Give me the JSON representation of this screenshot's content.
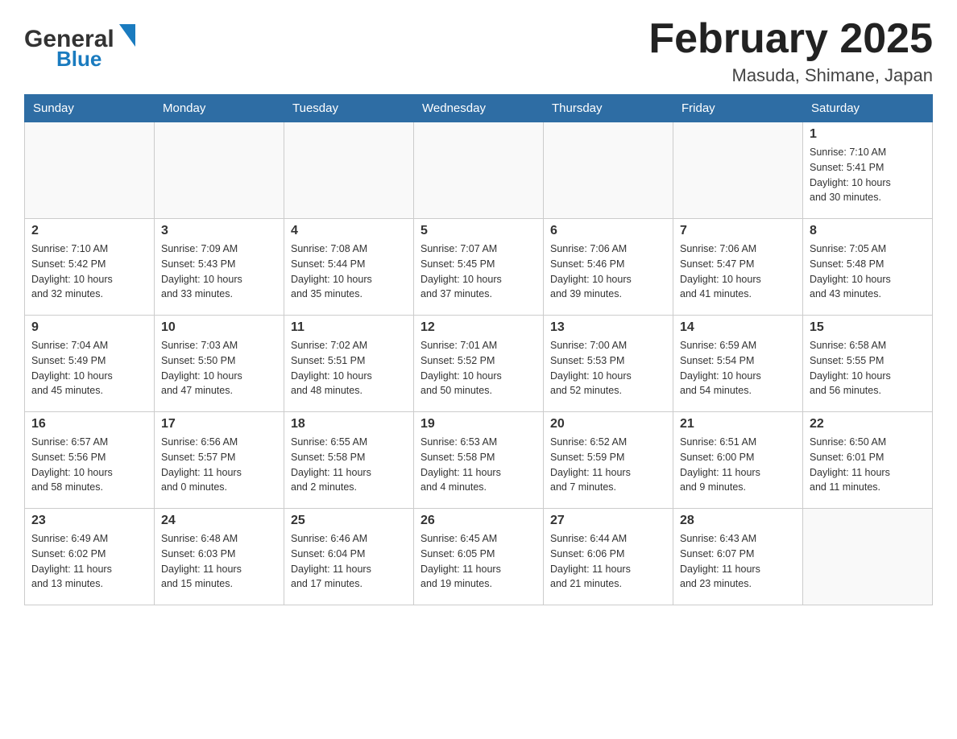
{
  "header": {
    "logo_general": "General",
    "logo_blue": "Blue",
    "month_title": "February 2025",
    "location": "Masuda, Shimane, Japan"
  },
  "weekdays": [
    "Sunday",
    "Monday",
    "Tuesday",
    "Wednesday",
    "Thursday",
    "Friday",
    "Saturday"
  ],
  "weeks": [
    [
      {
        "day": "",
        "info": ""
      },
      {
        "day": "",
        "info": ""
      },
      {
        "day": "",
        "info": ""
      },
      {
        "day": "",
        "info": ""
      },
      {
        "day": "",
        "info": ""
      },
      {
        "day": "",
        "info": ""
      },
      {
        "day": "1",
        "info": "Sunrise: 7:10 AM\nSunset: 5:41 PM\nDaylight: 10 hours\nand 30 minutes."
      }
    ],
    [
      {
        "day": "2",
        "info": "Sunrise: 7:10 AM\nSunset: 5:42 PM\nDaylight: 10 hours\nand 32 minutes."
      },
      {
        "day": "3",
        "info": "Sunrise: 7:09 AM\nSunset: 5:43 PM\nDaylight: 10 hours\nand 33 minutes."
      },
      {
        "day": "4",
        "info": "Sunrise: 7:08 AM\nSunset: 5:44 PM\nDaylight: 10 hours\nand 35 minutes."
      },
      {
        "day": "5",
        "info": "Sunrise: 7:07 AM\nSunset: 5:45 PM\nDaylight: 10 hours\nand 37 minutes."
      },
      {
        "day": "6",
        "info": "Sunrise: 7:06 AM\nSunset: 5:46 PM\nDaylight: 10 hours\nand 39 minutes."
      },
      {
        "day": "7",
        "info": "Sunrise: 7:06 AM\nSunset: 5:47 PM\nDaylight: 10 hours\nand 41 minutes."
      },
      {
        "day": "8",
        "info": "Sunrise: 7:05 AM\nSunset: 5:48 PM\nDaylight: 10 hours\nand 43 minutes."
      }
    ],
    [
      {
        "day": "9",
        "info": "Sunrise: 7:04 AM\nSunset: 5:49 PM\nDaylight: 10 hours\nand 45 minutes."
      },
      {
        "day": "10",
        "info": "Sunrise: 7:03 AM\nSunset: 5:50 PM\nDaylight: 10 hours\nand 47 minutes."
      },
      {
        "day": "11",
        "info": "Sunrise: 7:02 AM\nSunset: 5:51 PM\nDaylight: 10 hours\nand 48 minutes."
      },
      {
        "day": "12",
        "info": "Sunrise: 7:01 AM\nSunset: 5:52 PM\nDaylight: 10 hours\nand 50 minutes."
      },
      {
        "day": "13",
        "info": "Sunrise: 7:00 AM\nSunset: 5:53 PM\nDaylight: 10 hours\nand 52 minutes."
      },
      {
        "day": "14",
        "info": "Sunrise: 6:59 AM\nSunset: 5:54 PM\nDaylight: 10 hours\nand 54 minutes."
      },
      {
        "day": "15",
        "info": "Sunrise: 6:58 AM\nSunset: 5:55 PM\nDaylight: 10 hours\nand 56 minutes."
      }
    ],
    [
      {
        "day": "16",
        "info": "Sunrise: 6:57 AM\nSunset: 5:56 PM\nDaylight: 10 hours\nand 58 minutes."
      },
      {
        "day": "17",
        "info": "Sunrise: 6:56 AM\nSunset: 5:57 PM\nDaylight: 11 hours\nand 0 minutes."
      },
      {
        "day": "18",
        "info": "Sunrise: 6:55 AM\nSunset: 5:58 PM\nDaylight: 11 hours\nand 2 minutes."
      },
      {
        "day": "19",
        "info": "Sunrise: 6:53 AM\nSunset: 5:58 PM\nDaylight: 11 hours\nand 4 minutes."
      },
      {
        "day": "20",
        "info": "Sunrise: 6:52 AM\nSunset: 5:59 PM\nDaylight: 11 hours\nand 7 minutes."
      },
      {
        "day": "21",
        "info": "Sunrise: 6:51 AM\nSunset: 6:00 PM\nDaylight: 11 hours\nand 9 minutes."
      },
      {
        "day": "22",
        "info": "Sunrise: 6:50 AM\nSunset: 6:01 PM\nDaylight: 11 hours\nand 11 minutes."
      }
    ],
    [
      {
        "day": "23",
        "info": "Sunrise: 6:49 AM\nSunset: 6:02 PM\nDaylight: 11 hours\nand 13 minutes."
      },
      {
        "day": "24",
        "info": "Sunrise: 6:48 AM\nSunset: 6:03 PM\nDaylight: 11 hours\nand 15 minutes."
      },
      {
        "day": "25",
        "info": "Sunrise: 6:46 AM\nSunset: 6:04 PM\nDaylight: 11 hours\nand 17 minutes."
      },
      {
        "day": "26",
        "info": "Sunrise: 6:45 AM\nSunset: 6:05 PM\nDaylight: 11 hours\nand 19 minutes."
      },
      {
        "day": "27",
        "info": "Sunrise: 6:44 AM\nSunset: 6:06 PM\nDaylight: 11 hours\nand 21 minutes."
      },
      {
        "day": "28",
        "info": "Sunrise: 6:43 AM\nSunset: 6:07 PM\nDaylight: 11 hours\nand 23 minutes."
      },
      {
        "day": "",
        "info": ""
      }
    ]
  ]
}
